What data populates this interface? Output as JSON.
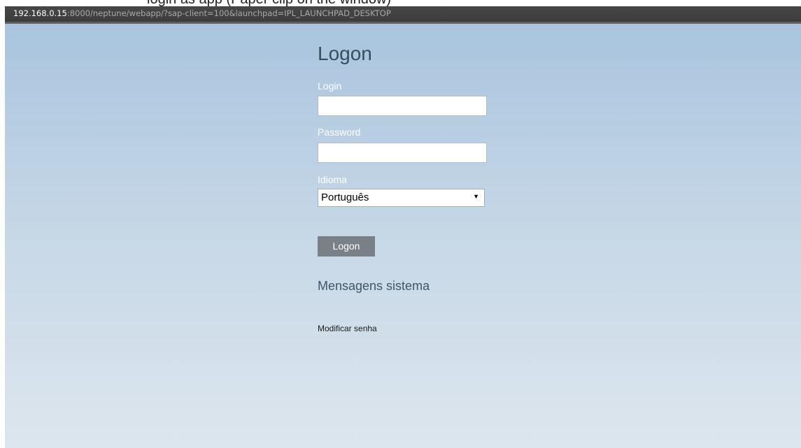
{
  "top_clipped_text": "login as app (Paper clip on the window)",
  "browser": {
    "url_host": "192.168.0.15",
    "url_rest": ":8000/neptune/webapp/?sap-client=100&launchpad=IPL_LAUNCHPAD_DESKTOP"
  },
  "form": {
    "title": "Logon",
    "login_label": "Login",
    "login_value": "",
    "password_label": "Password",
    "password_value": "",
    "language_label": "Idioma",
    "language_selected": "Português",
    "logon_button": "Logon",
    "messages_title": "Mensagens sistema",
    "change_password_link": "Modificar senha"
  },
  "colors": {
    "browser_bar": "#404040",
    "page_gradient_top": "#a9c4de",
    "page_gradient_bottom": "#dde6ee",
    "title_text": "#324f5f",
    "button_bg": "#7a8088"
  },
  "icons": {
    "select_arrow": "dropdown-arrow-icon"
  }
}
